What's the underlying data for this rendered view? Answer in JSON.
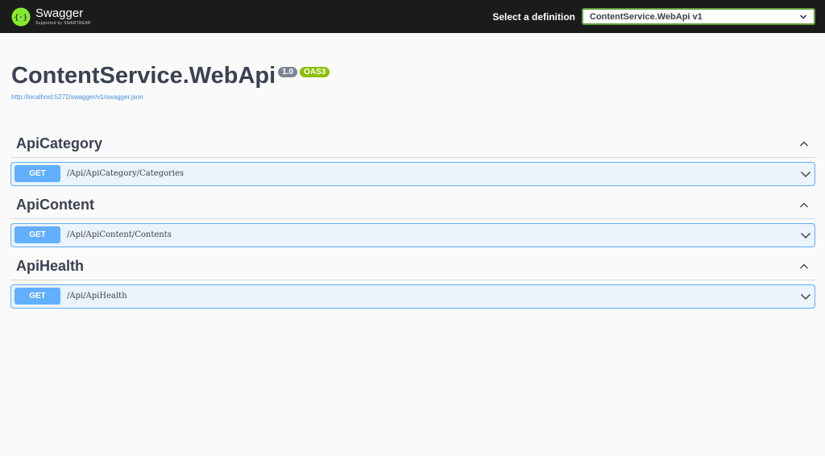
{
  "header": {
    "brand_name": "Swagger",
    "brand_sub": "Supported by SMARTBEAR",
    "definition_label": "Select a definition",
    "definition_value": "ContentService.WebApi v1"
  },
  "info": {
    "title": "ContentService.WebApi",
    "version": "1.0",
    "oas": "OAS3",
    "spec_url": "http://localhost:5272/swagger/v1/swagger.json"
  },
  "tags": [
    {
      "name": "ApiCategory",
      "ops": [
        {
          "method": "GET",
          "path": "/Api/ApiCategory/Categories"
        }
      ]
    },
    {
      "name": "ApiContent",
      "ops": [
        {
          "method": "GET",
          "path": "/Api/ApiContent/Contents"
        }
      ]
    },
    {
      "name": "ApiHealth",
      "ops": [
        {
          "method": "GET",
          "path": "/Api/ApiHealth"
        }
      ]
    }
  ],
  "colors": {
    "topbar": "#1b1b1b",
    "get_method": "#61affe",
    "get_background": "#ebf3fb",
    "oas_badge": "#89bf04",
    "version_badge": "#7d8492",
    "select_border": "#62a03f"
  },
  "icons": {
    "logo": "swagger-logo-icon",
    "select": "chevron-down-icon",
    "tag_toggle": "chevron-up-icon",
    "op_toggle": "chevron-down-icon"
  }
}
